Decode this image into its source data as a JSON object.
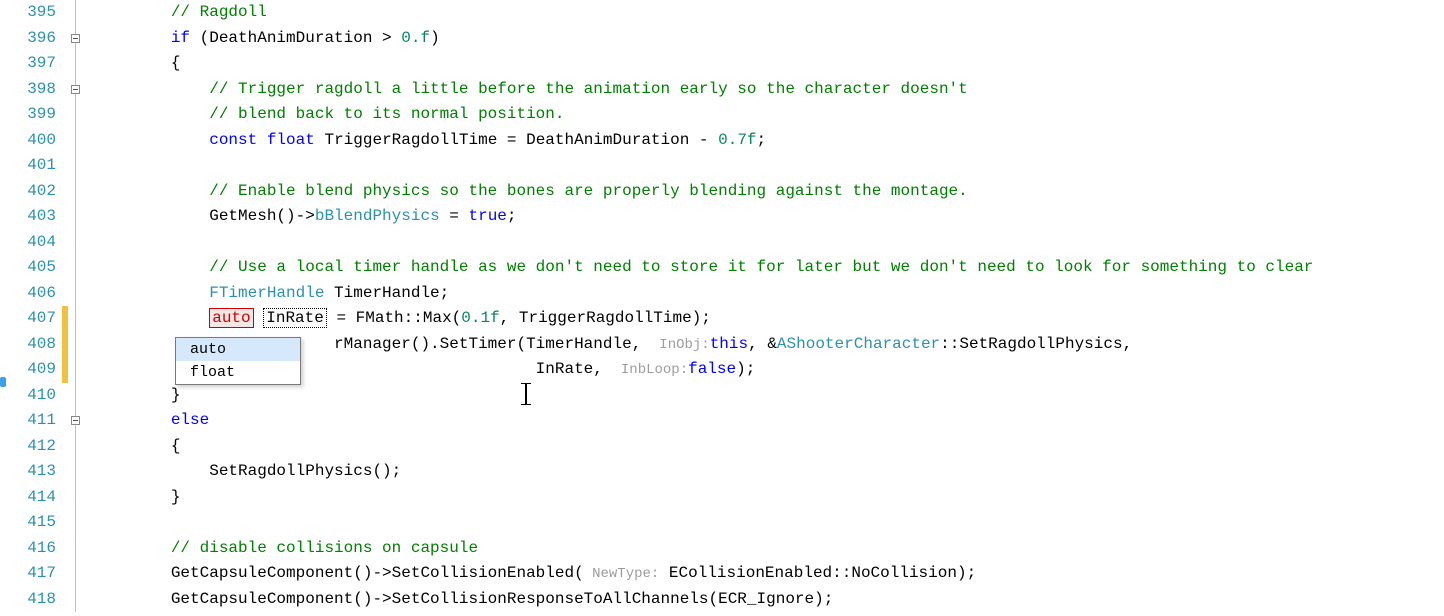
{
  "lines": [
    {
      "num": "395",
      "fold": null,
      "html": "<span class='c-comment'>// Ragdoll</span>",
      "indent": 2
    },
    {
      "num": "396",
      "fold": "box",
      "html": "<span class='c-keyword'>if</span><span class='c-plain'> (DeathAnimDuration &gt; </span><span class='c-num'>0.f</span><span class='c-plain'>)</span>",
      "indent": 2
    },
    {
      "num": "397",
      "fold": null,
      "html": "<span class='c-plain'>{</span>",
      "indent": 2
    },
    {
      "num": "398",
      "fold": "box",
      "html": "<span class='c-comment'>// Trigger ragdoll a little before the animation early so the character doesn't</span>",
      "indent": 3
    },
    {
      "num": "399",
      "fold": null,
      "html": "<span class='c-comment'>// blend back to its normal position.</span>",
      "indent": 3
    },
    {
      "num": "400",
      "fold": null,
      "html": "<span class='c-keyword'>const</span><span class='c-plain'> </span><span class='c-keyword'>float</span><span class='c-plain'> TriggerRagdollTime = DeathAnimDuration - </span><span class='c-num'>0.7f</span><span class='c-plain'>;</span>",
      "indent": 3
    },
    {
      "num": "401",
      "fold": null,
      "html": "",
      "indent": 0
    },
    {
      "num": "402",
      "fold": null,
      "html": "<span class='c-comment'>// Enable blend physics so the bones are properly blending against the montage.</span>",
      "indent": 3
    },
    {
      "num": "403",
      "fold": null,
      "html": "<span class='c-plain'>GetMesh()-&gt;</span><span class='c-type'>bBlendPhysics</span><span class='c-plain'> = </span><span class='c-keyword'>true</span><span class='c-plain'>;</span>",
      "indent": 3
    },
    {
      "num": "404",
      "fold": null,
      "html": "",
      "indent": 0
    },
    {
      "num": "405",
      "fold": null,
      "html": "<span class='c-comment'>// Use a local timer handle as we don't need to store it for later but we don't need to look for something to clear</span>",
      "indent": 3
    },
    {
      "num": "406",
      "fold": null,
      "html": "<span class='c-type'>FTimerHandle</span><span class='c-plain'> TimerHandle;</span>",
      "indent": 3
    },
    {
      "num": "407",
      "fold": null,
      "html": "<span class='auto-box'>auto</span> <span class='var-box'>InRate</span><span class='c-plain'> = FMath::Max(</span><span class='c-num'>0.1f</span><span class='c-plain'>, TriggerRagdollTime);</span>",
      "indent": 3,
      "changed": true
    },
    {
      "num": "408",
      "fold": null,
      "html": "<span class='c-plain'>             rManager().SetTimer(TimerHandle, </span><span class='c-hint'> InObj:</span><span class='c-keyword'>this</span><span class='c-plain'>, &amp;</span><span class='c-type'>AShooterCharacter</span><span class='c-plain'>::SetRagdollPhysics,</span>",
      "indent": 3,
      "changed": true
    },
    {
      "num": "409",
      "fold": null,
      "html": "<span class='c-plain'>                                  InRate, </span><span class='c-hint'> InbLoop:</span><span class='c-keyword'>false</span><span class='c-plain'>);</span>",
      "indent": 3,
      "changed": true
    },
    {
      "num": "410",
      "fold": null,
      "html": "<span class='c-plain'>}</span>",
      "indent": 2
    },
    {
      "num": "411",
      "fold": "box",
      "html": "<span class='c-keyword'>else</span>",
      "indent": 2
    },
    {
      "num": "412",
      "fold": null,
      "html": "<span class='c-plain'>{</span>",
      "indent": 2
    },
    {
      "num": "413",
      "fold": null,
      "html": "<span class='c-plain'>SetRagdollPhysics();</span>",
      "indent": 3
    },
    {
      "num": "414",
      "fold": null,
      "html": "<span class='c-plain'>}</span>",
      "indent": 2
    },
    {
      "num": "415",
      "fold": null,
      "html": "",
      "indent": 0
    },
    {
      "num": "416",
      "fold": null,
      "html": "<span class='c-comment'>// disable collisions on capsule</span>",
      "indent": 2
    },
    {
      "num": "417",
      "fold": null,
      "html": "<span class='c-plain'>GetCapsuleComponent()-&gt;SetCollisionEnabled(</span><span class='c-hint'> NewType:</span><span class='c-plain'> ECollisionEnabled::NoCollision);</span>",
      "indent": 2
    },
    {
      "num": "418",
      "fold": null,
      "html": "<span class='c-plain'>GetCapsuleComponent()-&gt;SetCollisionResponseToAllChannels(ECR_Ignore);</span>",
      "indent": 2
    }
  ],
  "popup": {
    "items": [
      "auto",
      "float"
    ],
    "selected": 0
  },
  "indent_unit": "    "
}
